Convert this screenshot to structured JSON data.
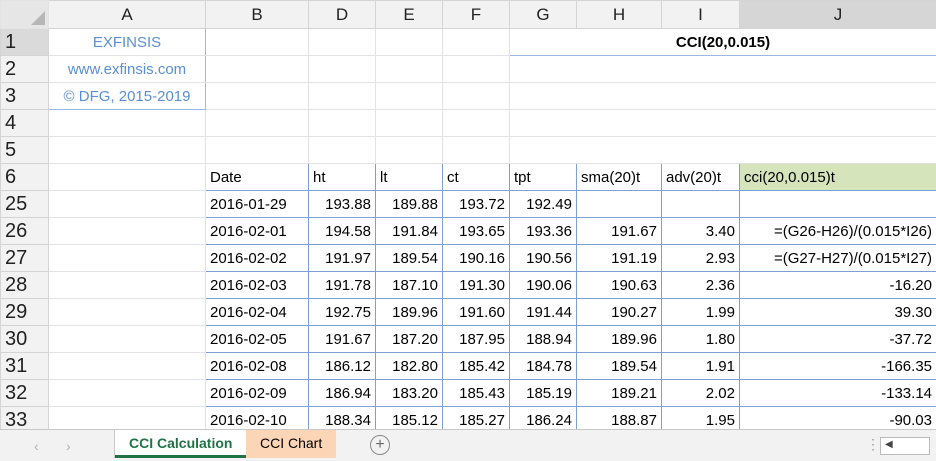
{
  "columns": [
    "A",
    "B",
    "D",
    "E",
    "F",
    "G",
    "H",
    "I",
    "J"
  ],
  "sidebar_label": {
    "line1": "EXFINSIS",
    "line2": "www.exfinsis.com",
    "line3": "© DFG, 2015-2019"
  },
  "title": "CCI(20,0.015)",
  "headers": [
    "Date",
    "ht",
    "lt",
    "ct",
    "tpt",
    "sma(20)t",
    "adv(20)t",
    "cci(20,0.015)t"
  ],
  "top_rows": [
    "1",
    "2",
    "3",
    "4",
    "5",
    "6"
  ],
  "data_rows": [
    {
      "rownum": "25",
      "date": "2016-01-29",
      "ht": "193.88",
      "lt": "189.88",
      "ct": "193.72",
      "tpt": "192.49",
      "sma": "",
      "adv": "",
      "cci": ""
    },
    {
      "rownum": "26",
      "date": "2016-02-01",
      "ht": "194.58",
      "lt": "191.84",
      "ct": "193.65",
      "tpt": "193.36",
      "sma": "191.67",
      "adv": "3.40",
      "cci": "=(G26-H26)/(0.015*I26)"
    },
    {
      "rownum": "27",
      "date": "2016-02-02",
      "ht": "191.97",
      "lt": "189.54",
      "ct": "190.16",
      "tpt": "190.56",
      "sma": "191.19",
      "adv": "2.93",
      "cci": "=(G27-H27)/(0.015*I27)"
    },
    {
      "rownum": "28",
      "date": "2016-02-03",
      "ht": "191.78",
      "lt": "187.10",
      "ct": "191.30",
      "tpt": "190.06",
      "sma": "190.63",
      "adv": "2.36",
      "cci": "-16.20"
    },
    {
      "rownum": "29",
      "date": "2016-02-04",
      "ht": "192.75",
      "lt": "189.96",
      "ct": "191.60",
      "tpt": "191.44",
      "sma": "190.27",
      "adv": "1.99",
      "cci": "39.30"
    },
    {
      "rownum": "30",
      "date": "2016-02-05",
      "ht": "191.67",
      "lt": "187.20",
      "ct": "187.95",
      "tpt": "188.94",
      "sma": "189.96",
      "adv": "1.80",
      "cci": "-37.72"
    },
    {
      "rownum": "31",
      "date": "2016-02-08",
      "ht": "186.12",
      "lt": "182.80",
      "ct": "185.42",
      "tpt": "184.78",
      "sma": "189.54",
      "adv": "1.91",
      "cci": "-166.35"
    },
    {
      "rownum": "32",
      "date": "2016-02-09",
      "ht": "186.94",
      "lt": "183.20",
      "ct": "185.43",
      "tpt": "185.19",
      "sma": "189.21",
      "adv": "2.02",
      "cci": "-133.14"
    },
    {
      "rownum": "33",
      "date": "2016-02-10",
      "ht": "188.34",
      "lt": "185.12",
      "ct": "185.27",
      "tpt": "186.24",
      "sma": "188.87",
      "adv": "1.95",
      "cci": "-90.03"
    }
  ],
  "tabs": {
    "active": "CCI Calculation",
    "other": "CCI Chart",
    "add": "+"
  },
  "colors": {
    "active_tab": "#217346",
    "chart_tab_bg": "#fbd5b5",
    "highlight_cell": "#d6e4bc",
    "brand_text": "#5b8ed6"
  }
}
